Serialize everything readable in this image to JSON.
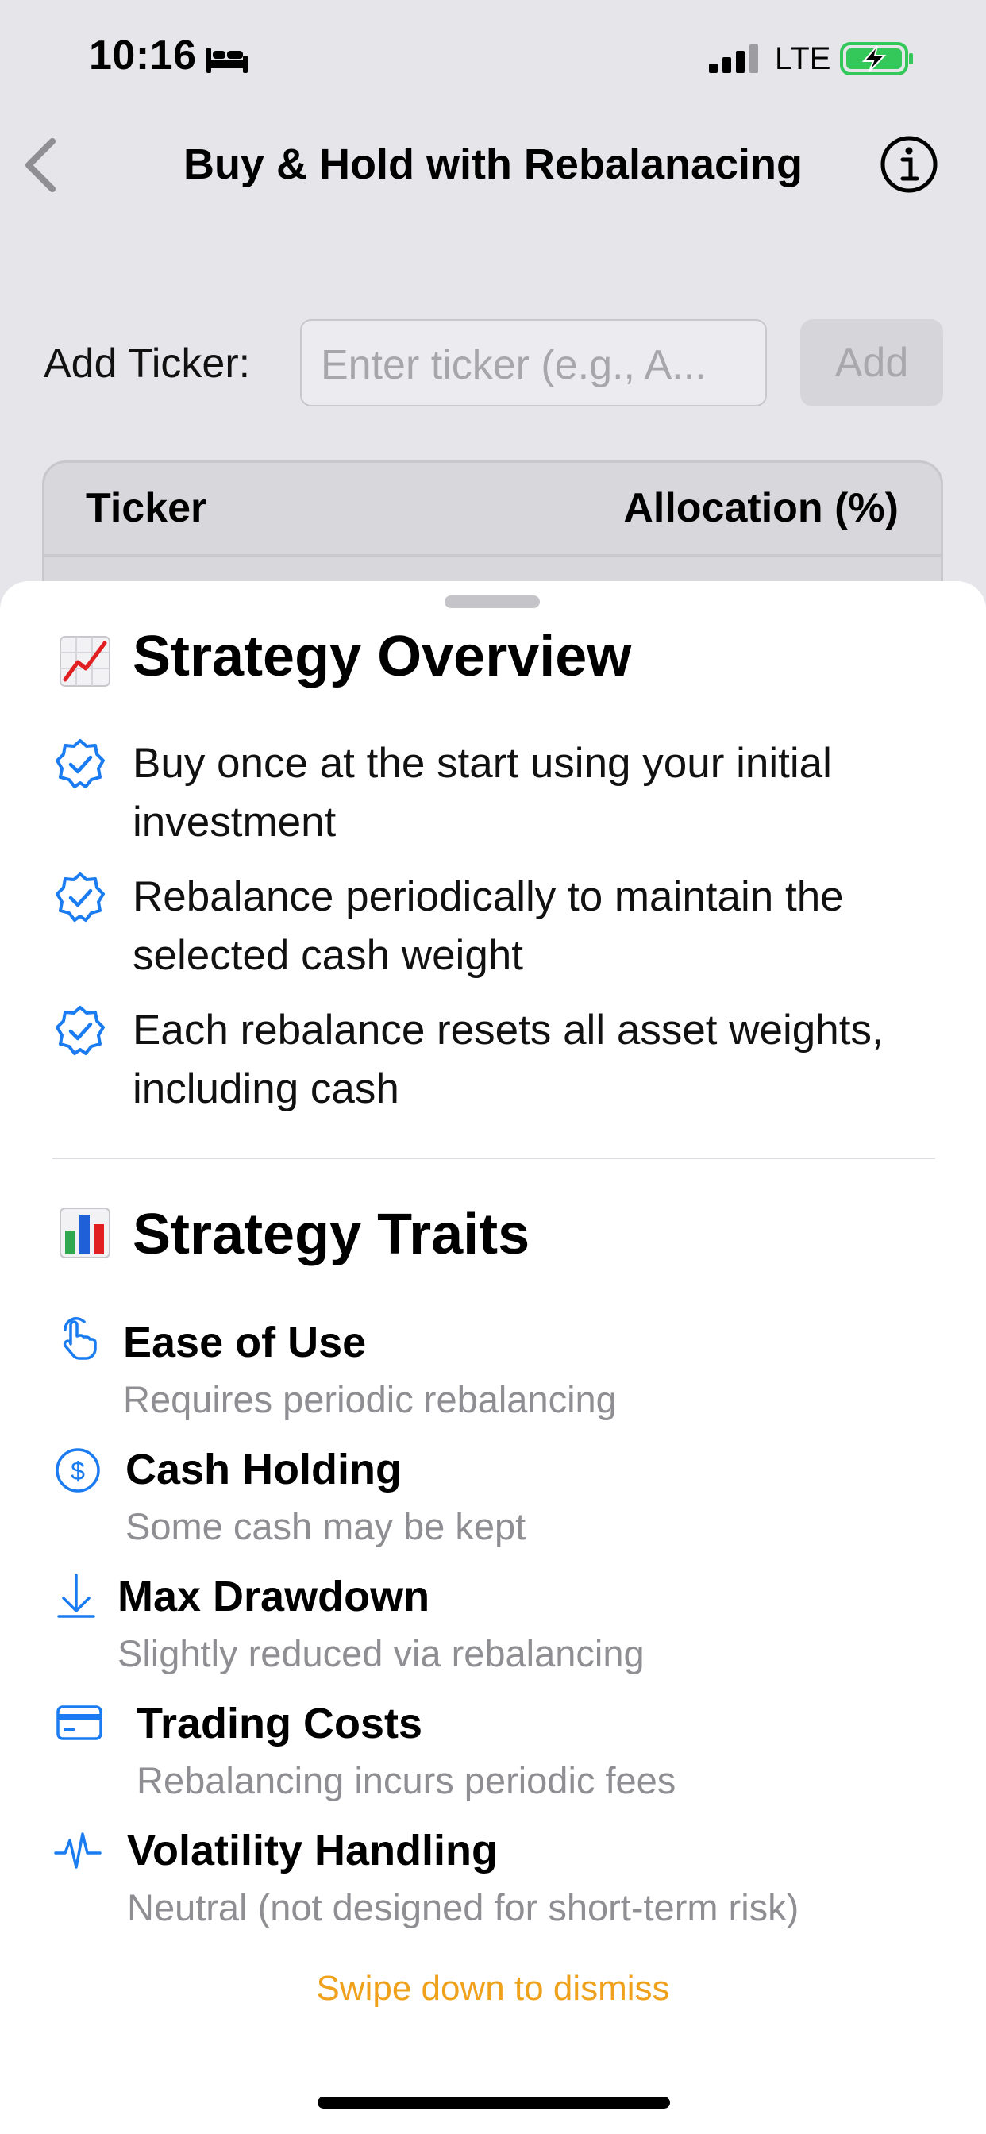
{
  "status_bar": {
    "time": "10:16",
    "network": "LTE",
    "sleep_focus_icon": "bed-icon",
    "battery_color": "#34c759"
  },
  "nav": {
    "title": "Buy & Hold with Rebalanacing",
    "back_icon": "chevron-left-icon",
    "info_icon": "info-circle-icon"
  },
  "add_ticker": {
    "label": "Add Ticker:",
    "placeholder": "Enter ticker (e.g., A...",
    "button_label": "Add"
  },
  "table": {
    "columns": [
      "Ticker",
      "Allocation (%)"
    ]
  },
  "sheet": {
    "overview": {
      "emoji": "chart-increasing-emoji",
      "title": "Strategy Overview",
      "bullets": [
        "Buy once at the start using your initial investment",
        "Rebalance periodically to maintain the selected cash weight",
        "Each rebalance resets all asset weights, including cash"
      ]
    },
    "traits": {
      "emoji": "bar-chart-emoji",
      "title": "Strategy Traits",
      "items": [
        {
          "icon": "hand-tap-icon",
          "title": "Ease of Use",
          "desc": "Requires periodic rebalancing"
        },
        {
          "icon": "dollar-circle-icon",
          "title": "Cash Holding",
          "desc": "Some cash may be kept"
        },
        {
          "icon": "arrow-down-icon",
          "title": "Max Drawdown",
          "desc": "Slightly reduced via rebalancing"
        },
        {
          "icon": "credit-card-icon",
          "title": "Trading Costs",
          "desc": "Rebalancing incurs periodic fees"
        },
        {
          "icon": "waveform-icon",
          "title": "Volatility Handling",
          "desc": "Neutral (not designed for short-term risk)"
        }
      ]
    },
    "dismiss_hint": "Swipe down to dismiss"
  },
  "colors": {
    "accent_blue": "#1a7cf0",
    "hint_orange": "#f0a11b",
    "secondary_text": "#8e8e93"
  }
}
